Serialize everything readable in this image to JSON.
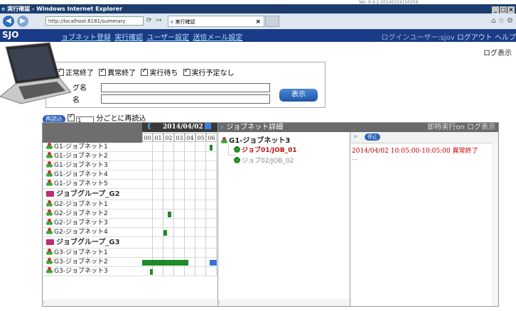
{
  "version": "Ver. 0.4.2.20140224150256",
  "window": {
    "title": "実行確認 - Windows Internet Explorer",
    "controls": [
      "_",
      "□",
      "×"
    ]
  },
  "browser": {
    "url": "http://localhost:8181/summary",
    "tab_title": "実行確認",
    "tab_close": "×",
    "tools": "⌂ ☆ ⚙"
  },
  "app": {
    "brand": "SJO",
    "menu": [
      "ョブネット登録",
      "実行確認",
      "ユーザー設定",
      "送信メール設定"
    ],
    "user_label": "ログインユーザー:sjov",
    "logout": "ログアウト",
    "help": "ヘルプ"
  },
  "log_view": "ログ表示",
  "filter": {
    "checkboxes": [
      {
        "label": "正常終了",
        "checked": true
      },
      {
        "label": "異常終了",
        "checked": true
      },
      {
        "label": "実行待ち",
        "checked": true
      },
      {
        "label": "実行予定なし",
        "checked": true
      }
    ],
    "field1_label": "グ名",
    "field2_label": "名",
    "show_button": "表示"
  },
  "reload": {
    "button": "再読込",
    "seconds": "1",
    "label": "分ごとに再読込",
    "checked": true
  },
  "timeline": {
    "prev": "《",
    "date": "2014/04/02",
    "hours": [
      "00",
      "01",
      "02",
      "03",
      "04",
      "05",
      "06"
    ]
  },
  "rows": [
    {
      "type": "net",
      "name": "G1-ジョブネット1"
    },
    {
      "type": "net",
      "name": "G1-ジョブネット2"
    },
    {
      "type": "net",
      "name": "G1-ジョブネット3"
    },
    {
      "type": "net",
      "name": "G1-ジョブネット4"
    },
    {
      "type": "net",
      "name": "G1-ジョブネット5"
    },
    {
      "type": "group",
      "name": "ジョブグループ_G2"
    },
    {
      "type": "net",
      "name": "G2-ジョブネット1"
    },
    {
      "type": "net",
      "name": "G2-ジョブネット2"
    },
    {
      "type": "net",
      "name": "G2-ジョブネット3"
    },
    {
      "type": "net",
      "name": "G2-ジョブネット4"
    },
    {
      "type": "group",
      "name": "ジョブグループ_G3"
    },
    {
      "type": "net",
      "name": "G3-ジョブネット1"
    },
    {
      "type": "net",
      "name": "G3-ジョブネット2"
    },
    {
      "type": "net",
      "name": "G3-ジョブネット3"
    }
  ],
  "colors": {
    "ok": "#1f8a2a",
    "scheduled": "#3a6fd8",
    "error": "#cc0000",
    "accent": "#1a3b86"
  },
  "detail": {
    "title": "ジョブネット詳細",
    "right_label": "即時実行on ログ表示",
    "net_name": "G1-ジョブネット3",
    "stop_button": "停止",
    "jobs": [
      {
        "name": "ジョブ01/JOB_01",
        "status": "2014/04/02 10:05:00-10:05:00 異常終了"
      },
      {
        "name": "ジョブ02/JOB_02",
        "status": "---"
      }
    ]
  }
}
